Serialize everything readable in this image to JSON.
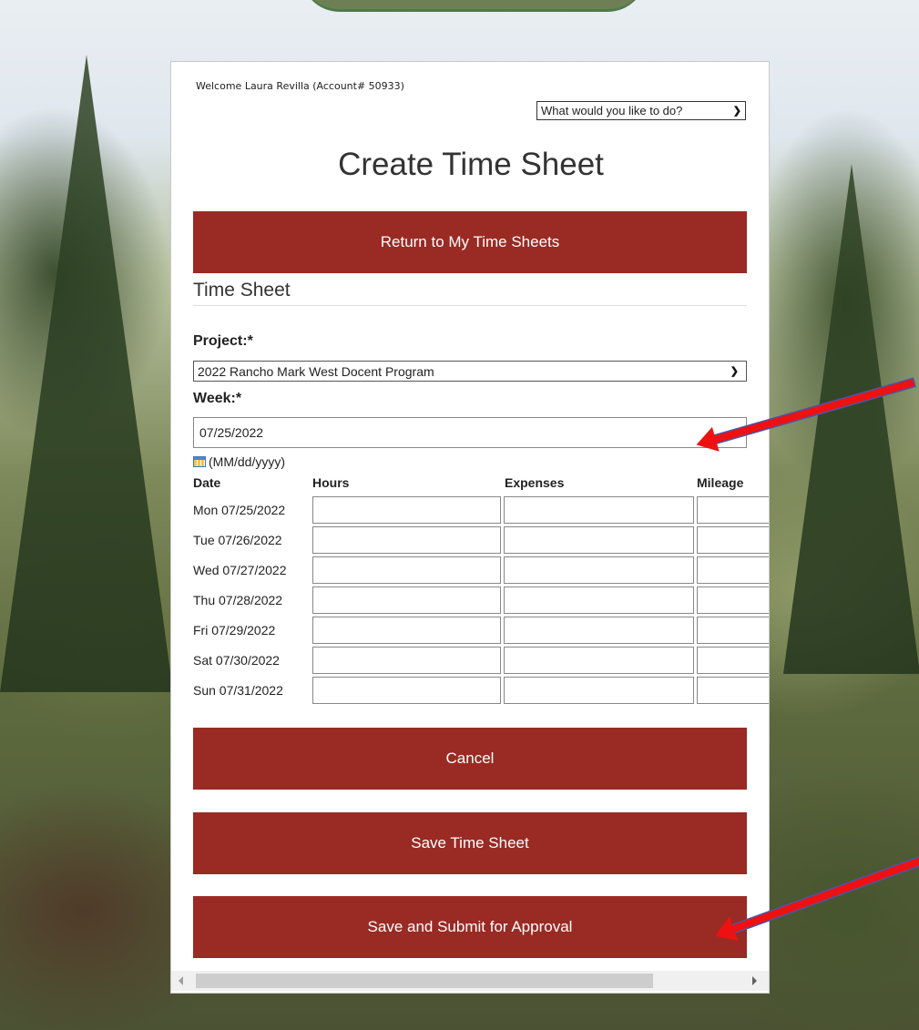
{
  "header": {
    "welcome": "Welcome Laura Revilla (Account# 50933)",
    "action_menu": "What would you like to do?",
    "title": "Create Time Sheet"
  },
  "buttons": {
    "return": "Return to My Time Sheets",
    "cancel": "Cancel",
    "save": "Save Time Sheet",
    "submit": "Save and Submit for Approval"
  },
  "form": {
    "section_title": "Time Sheet",
    "project_label": "Project:*",
    "project_value": "2022 Rancho Mark West Docent Program",
    "week_label": "Week:*",
    "week_value": "07/25/2022",
    "date_format": "(MM/dd/yyyy)"
  },
  "table": {
    "headers": [
      "Date",
      "Hours",
      "Expenses",
      "Mileage"
    ],
    "days": [
      "Mon 07/25/2022",
      "Tue 07/26/2022",
      "Wed 07/27/2022",
      "Thu 07/28/2022",
      "Fri 07/29/2022",
      "Sat 07/30/2022",
      "Sun 07/31/2022"
    ]
  },
  "colors": {
    "button": "#9a2a24",
    "annotation_arrow": "#ee1111"
  },
  "icons": [
    "chevron-down-icon",
    "calendar-icon",
    "scroll-left-icon",
    "scroll-right-icon"
  ]
}
